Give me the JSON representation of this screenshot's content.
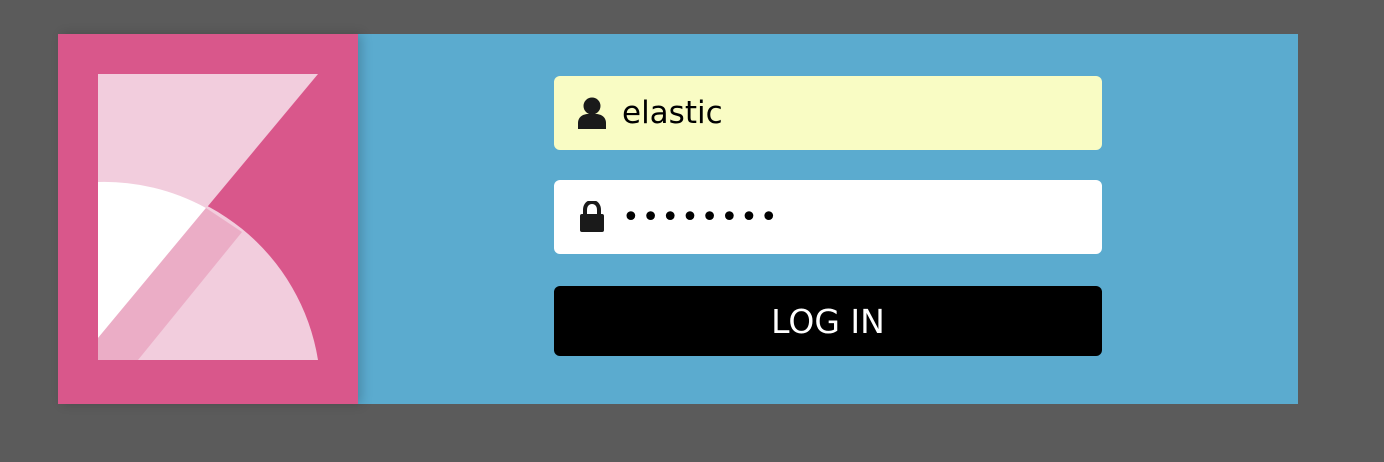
{
  "colors": {
    "page_background": "#5b5b5b",
    "logo_panel": "#d9578b",
    "form_panel": "#5babcf",
    "username_field": "#f9fcc4",
    "password_field": "#ffffff",
    "button": "#000000"
  },
  "logo": {
    "icon": "kibana-logo"
  },
  "form": {
    "username": {
      "icon": "user-icon",
      "value": "elastic",
      "placeholder": ""
    },
    "password": {
      "icon": "lock-icon",
      "value": "••••••••",
      "placeholder": ""
    },
    "login_label": "LOG IN"
  }
}
